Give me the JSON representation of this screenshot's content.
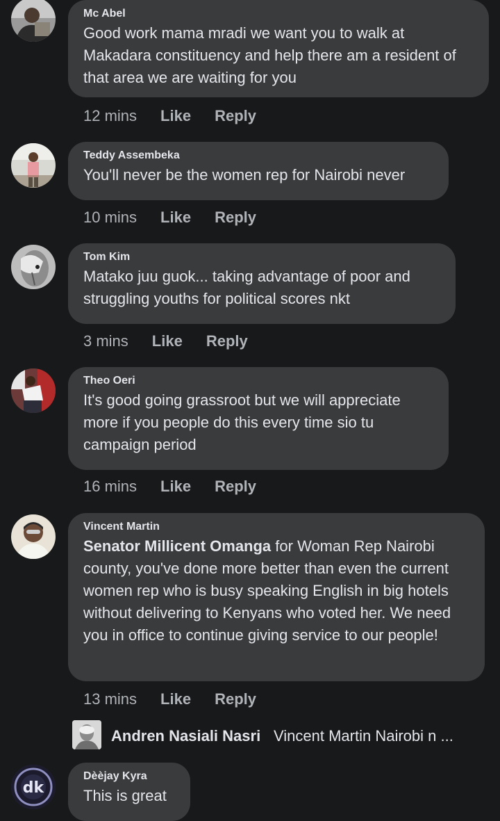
{
  "comments": [
    {
      "author": "Mc Abel",
      "text": "Good work mama mradi we want you to walk at Makadara constituency and help there am a resident of that area we are waiting for you",
      "time": "12 mins",
      "like": "Like",
      "reply": "Reply"
    },
    {
      "author": "Teddy Assembeka",
      "text": "You'll never be the women rep for Nairobi never",
      "time": "10 mins",
      "like": "Like",
      "reply": "Reply"
    },
    {
      "author": "Tom Kim",
      "text": "Matako juu guok... taking advantage of poor and struggling youths for political scores nkt",
      "time": "3 mins",
      "like": "Like",
      "reply": "Reply"
    },
    {
      "author": "Theo Oeri",
      "text": "It's good going grassroot but we will appreciate more if you people do this every time sio tu campaign period",
      "time": "16 mins",
      "like": "Like",
      "reply": "Reply"
    },
    {
      "author": "Vincent Martin",
      "mention": "Senator Millicent Omanga",
      "text": " for Woman Rep Nairobi county, you've done more better than even the current women rep who is busy speaking English in big hotels without delivering to Kenyans who voted her. We need you in office to continue giving service to our people!",
      "time": "13 mins",
      "like": "Like",
      "reply": "Reply"
    },
    {
      "author": "Dèèjay Kyra",
      "text": "This is great"
    }
  ],
  "reply_preview": {
    "author": "Andren Nasiali Nasri",
    "snippet": "Vincent Martin Nairobi n ..."
  },
  "avatar_badge": "dk",
  "colors": {
    "background": "#18191a",
    "bubble": "#3a3b3c",
    "text": "#e4e6eb",
    "secondary_text": "#b0b3b8"
  }
}
